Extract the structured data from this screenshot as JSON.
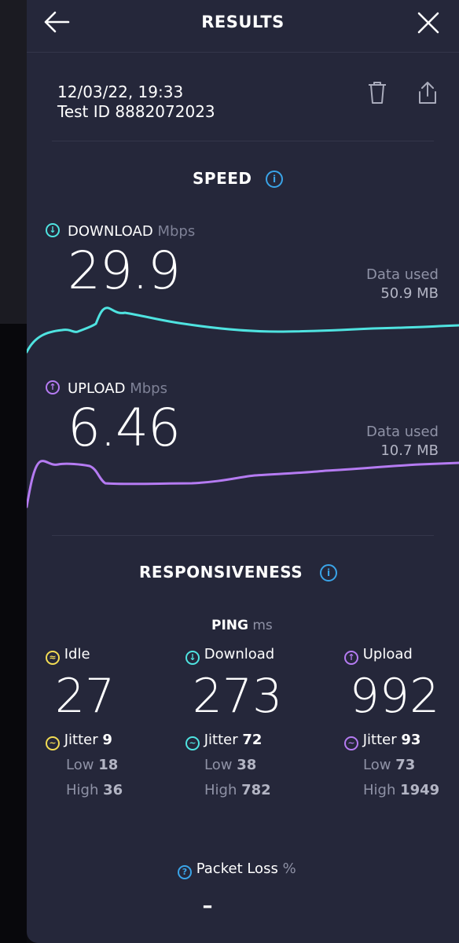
{
  "header": {
    "title": "RESULTS"
  },
  "test": {
    "datetime": "12/03/22, 19:33",
    "id_line": "Test ID 8882072023"
  },
  "speed": {
    "title": "SPEED",
    "download": {
      "label": "DOWNLOAD",
      "unit": "Mbps",
      "value": "29.9",
      "data_used_label": "Data used",
      "data_used": "50.9 MB",
      "color": "#4fe3e0"
    },
    "upload": {
      "label": "UPLOAD",
      "unit": "Mbps",
      "value": "6.46",
      "data_used_label": "Data used",
      "data_used": "10.7 MB",
      "color": "#b57bf2"
    }
  },
  "responsiveness": {
    "title": "RESPONSIVENESS",
    "ping_label": "PING",
    "ping_unit": "ms",
    "idle": {
      "label": "Idle",
      "value": "27",
      "jitter_label": "Jitter",
      "jitter": "9",
      "low_label": "Low",
      "low": "18",
      "high_label": "High",
      "high": "36",
      "color": "#f2dc54"
    },
    "download": {
      "label": "Download",
      "value": "273",
      "jitter_label": "Jitter",
      "jitter": "72",
      "low_label": "Low",
      "low": "38",
      "high_label": "High",
      "high": "782",
      "color": "#4fe3e0"
    },
    "upload": {
      "label": "Upload",
      "value": "992",
      "jitter_label": "Jitter",
      "jitter": "93",
      "low_label": "Low",
      "low": "73",
      "high_label": "High",
      "high": "1949",
      "color": "#b57bf2"
    }
  },
  "packet_loss": {
    "label": "Packet Loss",
    "unit": "%",
    "value": "–"
  }
}
